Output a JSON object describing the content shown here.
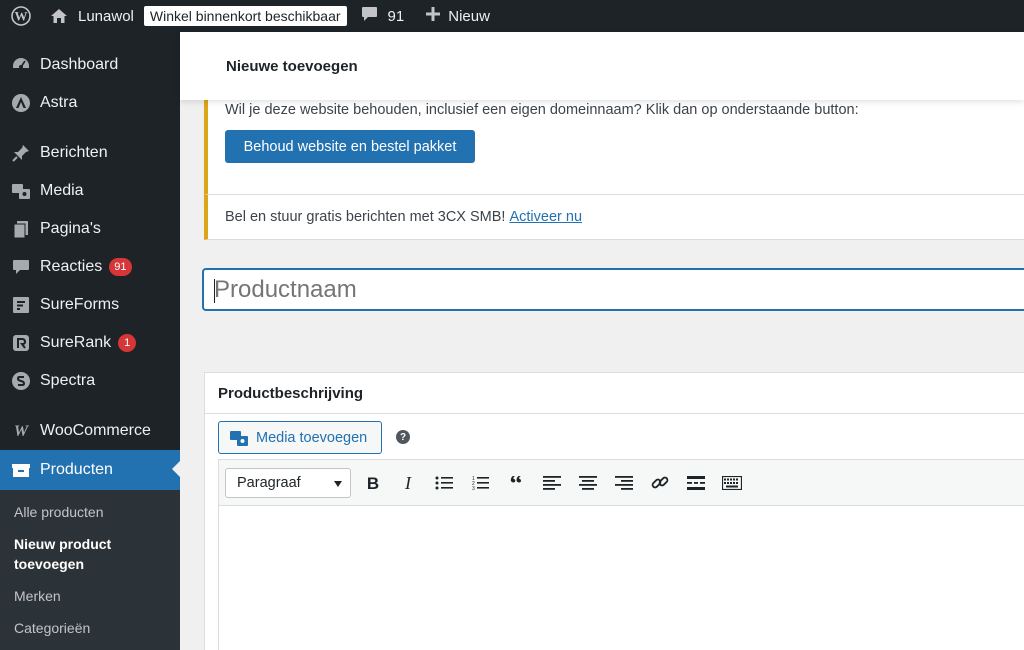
{
  "adminbar": {
    "site_name": "Lunawol",
    "status_badge": "Winkel binnenkort beschikbaar",
    "comments_count": "91",
    "new_label": "Nieuw"
  },
  "sidebar": {
    "items": [
      {
        "label": "Dashboard",
        "icon": "dashboard-icon"
      },
      {
        "label": "Astra",
        "icon": "astra-icon"
      },
      {
        "label": "Berichten",
        "icon": "pin-icon"
      },
      {
        "label": "Media",
        "icon": "media-icon"
      },
      {
        "label": "Pagina's",
        "icon": "pages-icon"
      },
      {
        "label": "Reacties",
        "icon": "comments-icon",
        "badge": "91"
      },
      {
        "label": "SureForms",
        "icon": "sureforms-icon"
      },
      {
        "label": "SureRank",
        "icon": "surerank-icon",
        "badge": "1"
      },
      {
        "label": "Spectra",
        "icon": "spectra-icon"
      },
      {
        "label": "WooCommerce",
        "icon": "woocommerce-icon"
      },
      {
        "label": "Producten",
        "icon": "products-icon"
      }
    ],
    "submenu": [
      "Alle producten",
      "Nieuw product toevoegen",
      "Merken",
      "Categorieën"
    ]
  },
  "header": {
    "title": "Nieuwe toevoegen"
  },
  "notice_website": {
    "text": "Wil je deze website behouden, inclusief een eigen domeinnaam? Klik dan op onderstaande button:",
    "button": "Behoud website en bestel pakket"
  },
  "notice_3cx": {
    "text": "Bel en stuur gratis berichten met 3CX SMB!",
    "link": "Activeer nu"
  },
  "title_field": {
    "placeholder": "Productnaam"
  },
  "description_box": {
    "title": "Productbeschrijving",
    "media_button": "Media toevoegen",
    "format_select": "Paragraaf",
    "toolbar_icons": [
      "bold-icon",
      "italic-icon",
      "bullet-list-icon",
      "numbered-list-icon",
      "blockquote-icon",
      "align-left-icon",
      "align-center-icon",
      "align-right-icon",
      "link-icon",
      "read-more-icon",
      "toolbar-toggle-icon"
    ]
  },
  "colors": {
    "accent": "#2271b1",
    "adminbar": "#1d2327",
    "notice_border": "#dba617",
    "badge": "#d63638"
  }
}
